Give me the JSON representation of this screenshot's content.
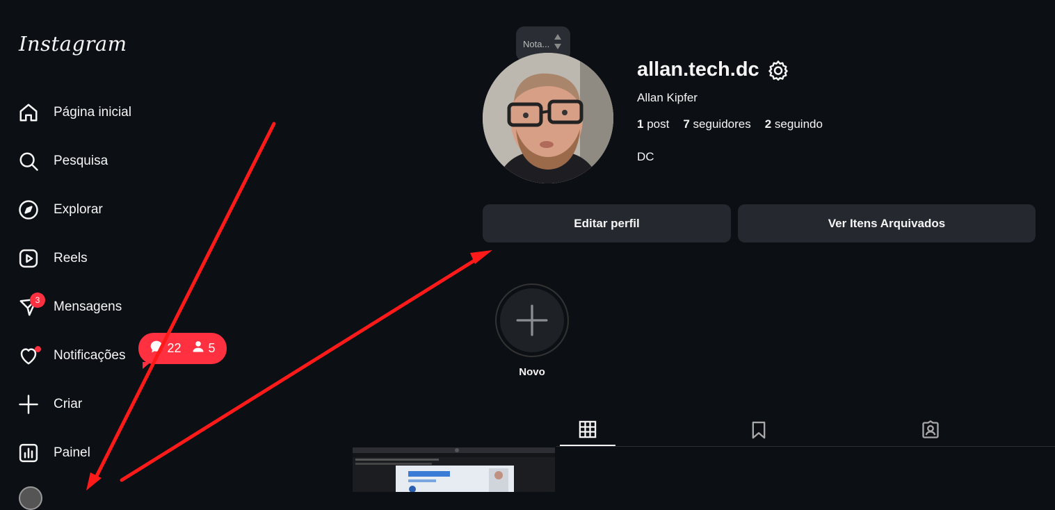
{
  "brand": {
    "logo": "Instagram"
  },
  "sidebar": {
    "items": [
      {
        "label": "Página inicial",
        "icon": "home-icon"
      },
      {
        "label": "Pesquisa",
        "icon": "search-icon"
      },
      {
        "label": "Explorar",
        "icon": "compass-icon"
      },
      {
        "label": "Reels",
        "icon": "reels-icon"
      },
      {
        "label": "Mensagens",
        "icon": "messenger-icon",
        "badge": "3"
      },
      {
        "label": "Notificações",
        "icon": "heart-icon"
      },
      {
        "label": "Criar",
        "icon": "plus-icon"
      },
      {
        "label": "Painel",
        "icon": "dashboard-icon"
      }
    ],
    "notification_popup": {
      "comments": "22",
      "followers": "5"
    }
  },
  "profile": {
    "note": "Nota...",
    "username": "allan.tech.dc",
    "full_name": "Allan Kipfer",
    "stats": {
      "posts_count": "1",
      "posts_label": "post",
      "followers_count": "7",
      "followers_label": "seguidores",
      "following_count": "2",
      "following_label": "seguindo"
    },
    "bio": "DC",
    "edit_button": "Editar perfil",
    "archive_button": "Ver Itens Arquivados",
    "new_highlight_label": "Novo"
  },
  "tabs": [
    {
      "icon": "grid-icon",
      "active": true
    },
    {
      "icon": "bookmark-icon",
      "active": false
    },
    {
      "icon": "tagged-icon",
      "active": false
    }
  ],
  "colors": {
    "background": "#0c0f14",
    "badge": "#ff3040",
    "button": "#25282e",
    "annotation_arrow": "#ff1a1a"
  }
}
